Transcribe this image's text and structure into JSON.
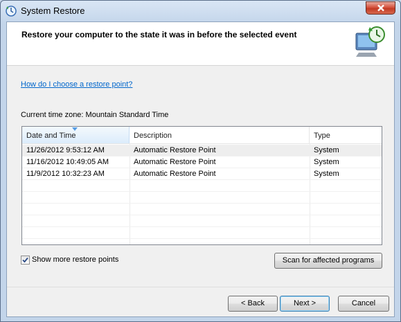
{
  "window": {
    "title": "System Restore"
  },
  "header": {
    "title": "Restore your computer to the state it was in before the selected event"
  },
  "help_link": "How do I choose a restore point?",
  "timezone_label": "Current time zone: Mountain Standard Time",
  "table": {
    "columns": [
      "Date and Time",
      "Description",
      "Type"
    ],
    "sorted_column": "Date and Time",
    "rows": [
      [
        "11/26/2012 9:53:12 AM",
        "Automatic Restore Point",
        "System"
      ],
      [
        "11/16/2012 10:49:05 AM",
        "Automatic Restore Point",
        "System"
      ],
      [
        "11/9/2012 10:32:23 AM",
        "Automatic Restore Point",
        "System"
      ]
    ]
  },
  "show_more": {
    "label": "Show more restore points",
    "checked": true
  },
  "buttons": {
    "scan": "Scan for affected programs",
    "back": "< Back",
    "next": "Next >",
    "cancel": "Cancel"
  },
  "icons": [
    "system-restore-icon",
    "close-icon",
    "restore-computer-icon",
    "sort-arrow-icon",
    "checkmark-icon"
  ],
  "colors": {
    "link": "#0066cc",
    "close_button": "#c23a24",
    "selected_row": "#eeeeee"
  }
}
